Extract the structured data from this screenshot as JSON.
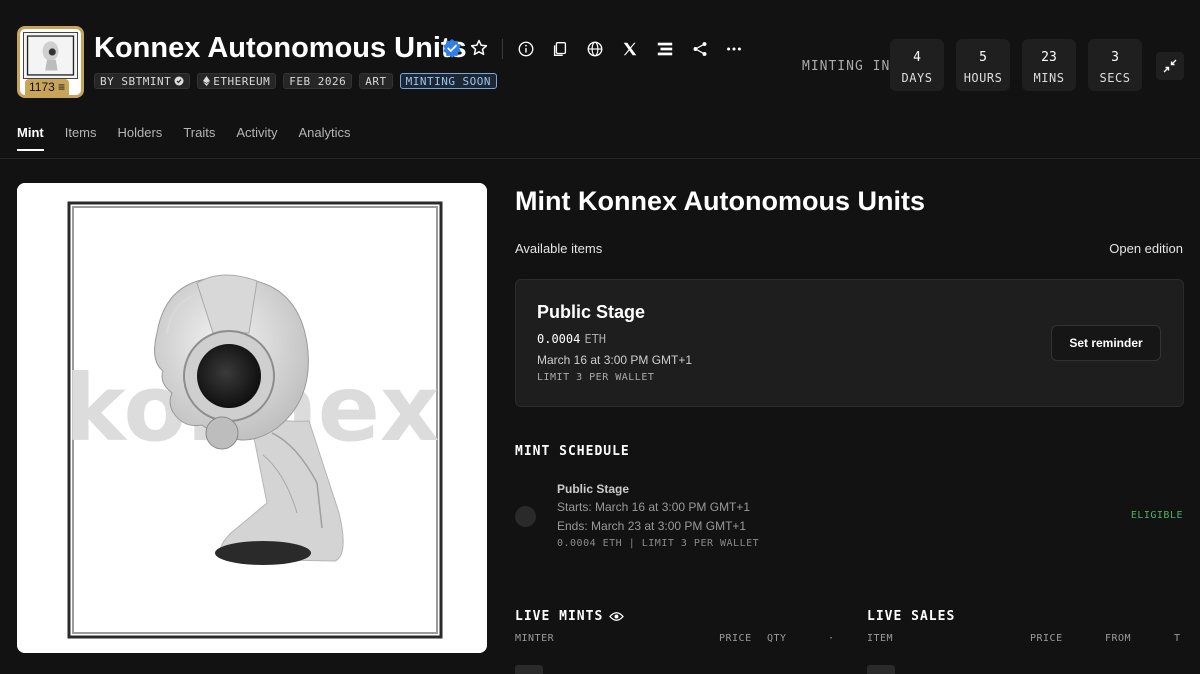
{
  "collection": {
    "name": "Konnex Autonomous Units",
    "badge_count": "1173",
    "tags": {
      "by": "BY SBTMINT",
      "chain": "ETHEREUM",
      "date": "FEB 2026",
      "category": "ART",
      "status": "MINTING SOON"
    }
  },
  "countdown": {
    "label": "MINTING IN",
    "days": {
      "value": "4",
      "unit": "DAYS"
    },
    "hours": {
      "value": "5",
      "unit": "HOURS"
    },
    "mins": {
      "value": "23",
      "unit": "MINS"
    },
    "secs": {
      "value": "3",
      "unit": "SECS"
    }
  },
  "tabs": [
    {
      "label": "Mint",
      "active": true
    },
    {
      "label": "Items"
    },
    {
      "label": "Holders"
    },
    {
      "label": "Traits"
    },
    {
      "label": "Activity"
    },
    {
      "label": "Analytics"
    }
  ],
  "artwork": {
    "watermark": "konnex"
  },
  "mint": {
    "title": "Mint Konnex Autonomous Units",
    "available_label": "Available items",
    "available_value": "Open edition",
    "stage": {
      "name": "Public Stage",
      "price": "0.0004",
      "currency": "ETH",
      "date": "March 16 at 3:00 PM GMT+1",
      "limit": "LIMIT 3 PER WALLET",
      "reminder_label": "Set reminder"
    },
    "schedule": {
      "heading": "MINT SCHEDULE",
      "name": "Public Stage",
      "starts": "Starts: March 16 at 3:00 PM GMT+1",
      "ends": "Ends: March 23 at 3:00 PM GMT+1",
      "meta": "0.0004 ETH | LIMIT 3 PER WALLET",
      "status": "ELIGIBLE"
    }
  },
  "live_mints": {
    "heading": "LIVE MINTS",
    "columns": [
      "MINTER",
      "PRICE",
      "QTY",
      "·"
    ]
  },
  "live_sales": {
    "heading": "LIVE SALES",
    "columns": [
      "ITEM",
      "PRICE",
      "FROM",
      "T"
    ]
  },
  "colors": {
    "background": "#121212",
    "card": "#1e1e1e",
    "gold": "#c8a35a",
    "verified_blue": "#2f7fe6",
    "eligible_green": "#4caf62",
    "soon_blue": "#7aa6d8"
  }
}
